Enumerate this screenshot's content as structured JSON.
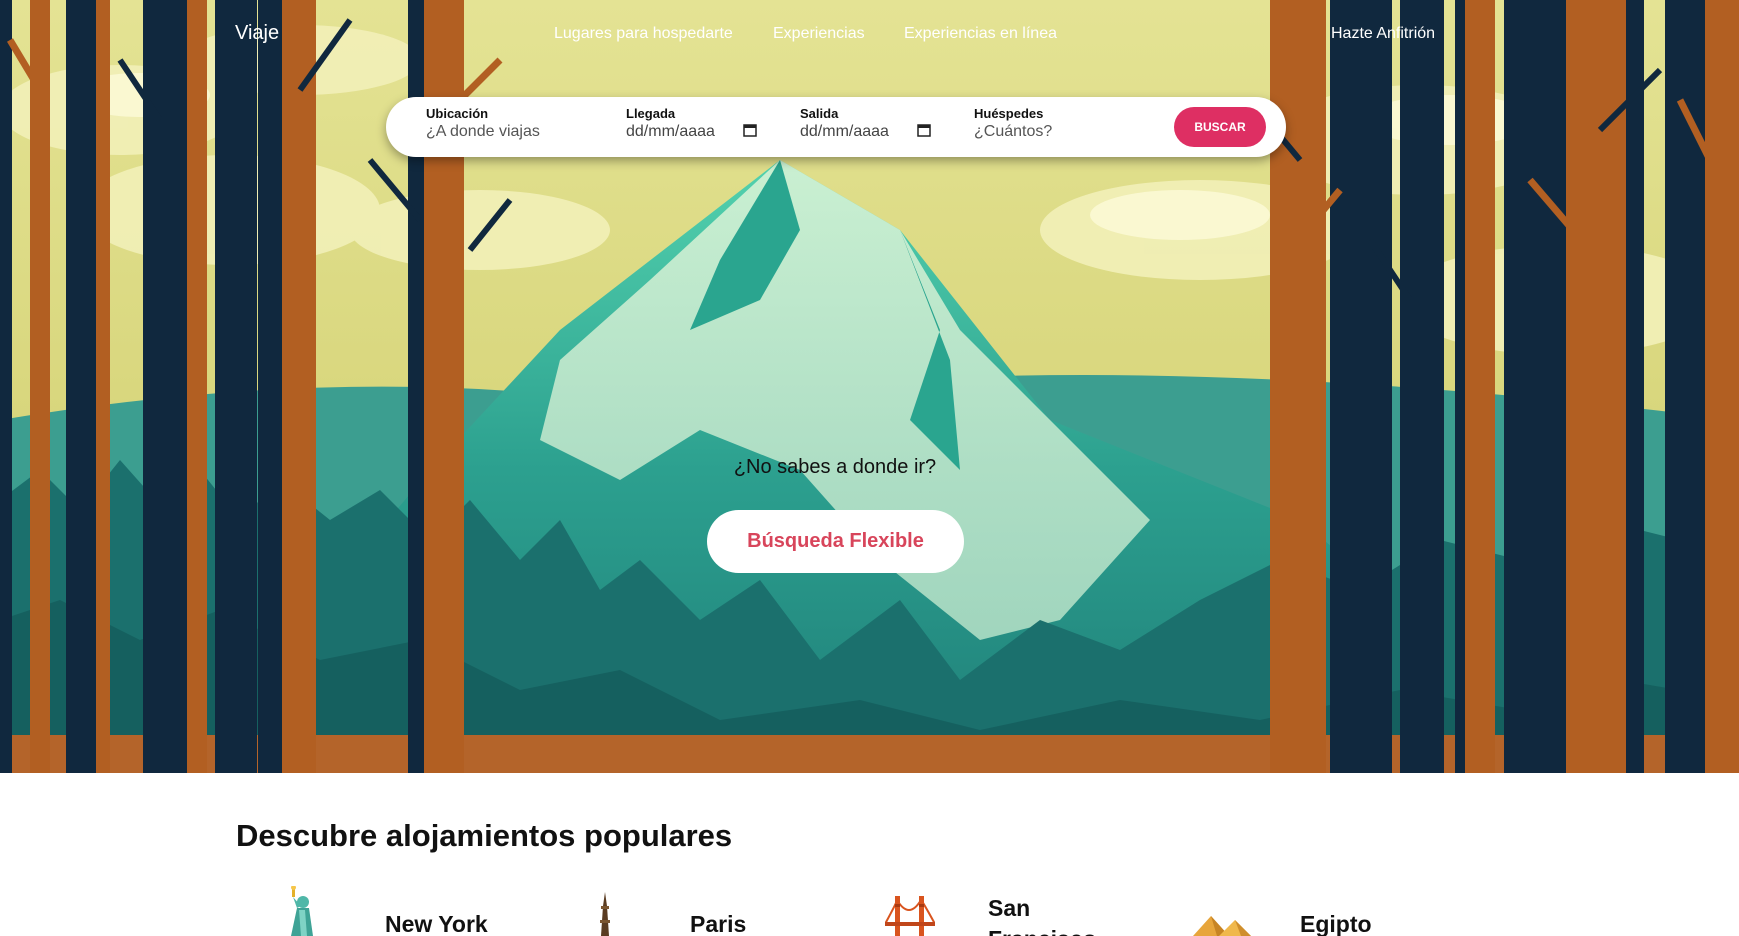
{
  "brand": "Viaje",
  "nav": [
    "Lugares para hospedarte",
    "Experiencias",
    "Experiencias en línea"
  ],
  "host_link": "Hazte Anfitrión",
  "search": {
    "location": {
      "label": "Ubicación",
      "placeholder": "¿A donde viajas"
    },
    "arrival": {
      "label": "Llegada",
      "value": "dd/mm/aaaa"
    },
    "departure": {
      "label": "Salida",
      "value": "dd/mm/aaaa"
    },
    "guests": {
      "label": "Huéspedes",
      "placeholder": "¿Cuántos?"
    },
    "button": "BUSCAR"
  },
  "hero": {
    "question": "¿No sabes a donde ir?",
    "flex_button": "Búsqueda Flexible"
  },
  "popular": {
    "title": "Descubre alojamientos populares",
    "cities": [
      "New York",
      "Paris",
      "San Francisco",
      "Egipto"
    ]
  },
  "colors": {
    "accent": "#de2f63",
    "flex_text": "#d8455b",
    "sky": "#e2e08c",
    "mountain": "#2a9d8f",
    "trunk_brown": "#b25f22",
    "trunk_navy": "#10283e"
  },
  "icons": [
    "calendar-icon",
    "statue-of-liberty-icon",
    "eiffel-tower-icon",
    "golden-gate-bridge-icon",
    "pyramids-icon"
  ]
}
